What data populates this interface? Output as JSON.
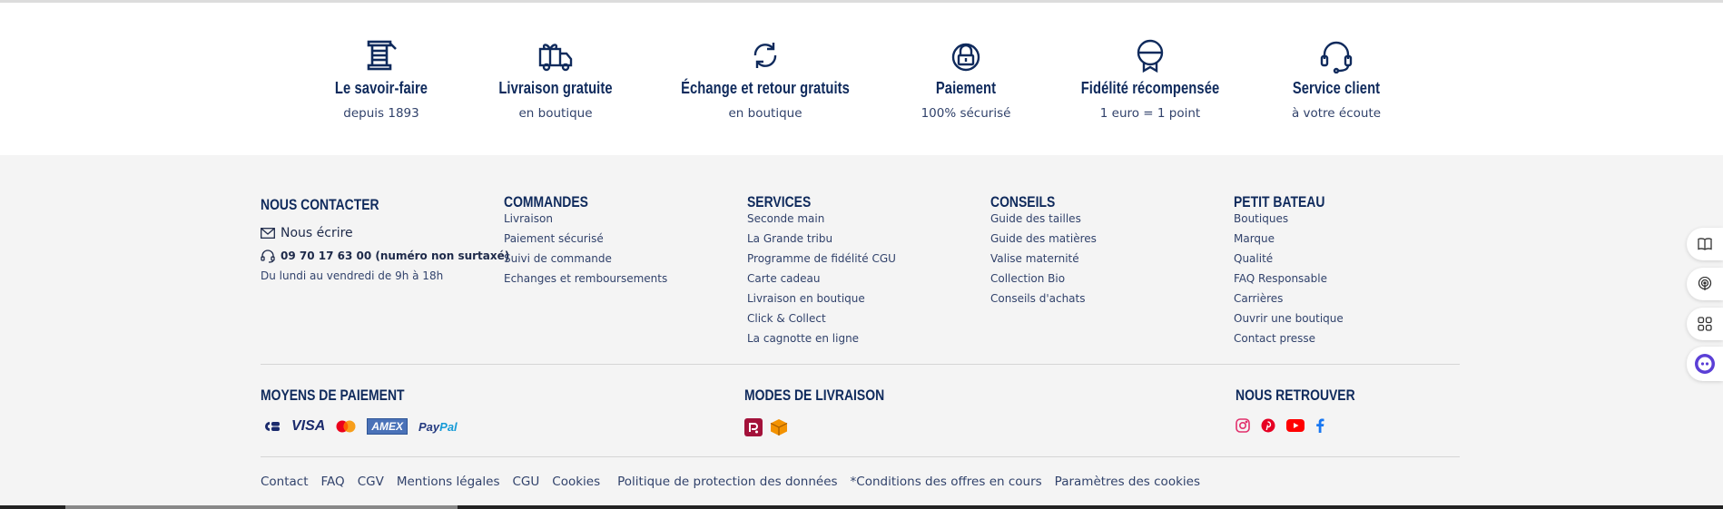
{
  "reassurance": [
    {
      "icon": "spool-icon",
      "title": "Le savoir-faire",
      "subtitle": "depuis 1893"
    },
    {
      "icon": "gift-truck-icon",
      "title": "Livraison gratuite",
      "subtitle": "en boutique"
    },
    {
      "icon": "refresh-icon",
      "title": "Échange et retour gratuits",
      "subtitle": "en boutique"
    },
    {
      "icon": "lock-icon",
      "title": "Paiement",
      "subtitle": "100% sécurisé"
    },
    {
      "icon": "medal-icon",
      "title": "Fidélité récompensée",
      "subtitle": "1 euro = 1 point"
    },
    {
      "icon": "headset-icon",
      "title": "Service client",
      "subtitle": "à votre écoute"
    }
  ],
  "contact": {
    "title": "NOUS CONTACTER",
    "write": "Nous écrire",
    "phone": "09 70 17 63 00 (numéro non surtaxé)",
    "hours": "Du lundi au vendredi de 9h à 18h"
  },
  "columns": [
    {
      "title": "COMMANDES",
      "items": [
        "Livraison",
        "Paiement sécurisé",
        "Suivi de commande",
        "Echanges et remboursements"
      ]
    },
    {
      "title": "SERVICES",
      "items": [
        "Seconde main",
        "La Grande tribu",
        "Programme de fidélité CGU",
        "Carte cadeau",
        "Livraison en boutique",
        "Click & Collect",
        "La cagnotte en ligne"
      ]
    },
    {
      "title": "CONSEILS",
      "items": [
        "Guide des tailles",
        "Guide des matières",
        "Valise maternité",
        "Collection Bio",
        "Conseils d'achats"
      ]
    },
    {
      "title": "PETIT BATEAU",
      "items": [
        "Boutiques",
        "Marque",
        "Qualité",
        "FAQ Responsable",
        "Carrières",
        "Ouvrir une boutique",
        "Contact presse"
      ]
    }
  ],
  "payment": {
    "title": "MOYENS DE PAIEMENT",
    "visa": "VISA",
    "amex": "AMEX",
    "paypal_a": "Pay",
    "paypal_b": "Pal"
  },
  "shipping": {
    "title": "MODES DE LIVRAISON"
  },
  "social": {
    "title": "NOUS RETROUVER"
  },
  "bottom_links": [
    "Contact",
    "FAQ",
    "CGV",
    "Mentions légales",
    "CGU",
    "Cookies",
    "Politique de protection des données",
    "*Conditions des offres en cours",
    "Paramètres des cookies"
  ],
  "colors": {
    "navy": "#0f2a5c",
    "text": "#31426b",
    "footer_bg": "#f4f4f4",
    "instagram": "#e1306c",
    "pinterest": "#e60023",
    "youtube": "#ff0000",
    "facebook": "#1877f2",
    "relay": "#a3123a",
    "colissimo": "#f39200"
  }
}
